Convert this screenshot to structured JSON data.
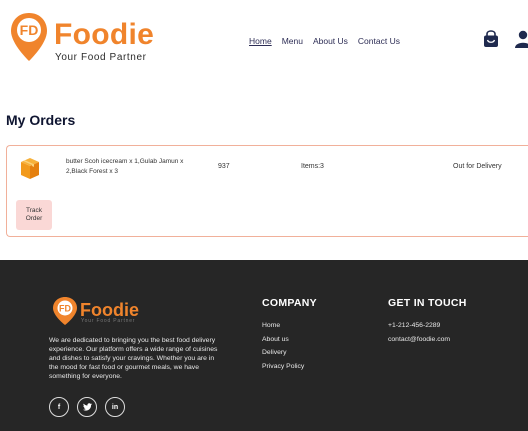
{
  "brand": {
    "name": "Foodie",
    "tagline": "Your Food Partner",
    "accent_color": "#f0842c"
  },
  "nav": {
    "items": [
      {
        "label": "Home",
        "active": true
      },
      {
        "label": "Menu"
      },
      {
        "label": "About Us"
      },
      {
        "label": "Contact Us"
      }
    ],
    "cart_icon": "shopping-bag-icon",
    "user_icon": "user-icon"
  },
  "orders": {
    "title": "My Orders",
    "list": [
      {
        "icon": "package-box-icon",
        "items_text": "butter Scoh icecream x 1,Gulab Jamun x 2,Black Forest x 3",
        "total": "937",
        "count": "Items:3",
        "status": "Out for Delivery",
        "track_label": "Track Order"
      }
    ]
  },
  "footer": {
    "brand_name": "Foodie",
    "brand_tagline": "Your Food Partner",
    "about": "We are dedicated to bringing you the best food delivery experience. Our platform offers a wide range of cuisines and dishes to satisfy your cravings. Whether you are in the mood for fast food or gourmet meals, we have something for everyone.",
    "socials": [
      {
        "name": "facebook-icon",
        "glyph": "f"
      },
      {
        "name": "twitter-icon",
        "glyph": "❧"
      },
      {
        "name": "linkedin-icon",
        "glyph": "in"
      }
    ],
    "company": {
      "title": "COMPANY",
      "links": [
        "Home",
        "About us",
        "Delivery",
        "Privacy Policy"
      ]
    },
    "contact": {
      "title": "GET IN TOUCH",
      "phone": "+1-212-456-2289",
      "email": "contact@foodie.com"
    }
  }
}
